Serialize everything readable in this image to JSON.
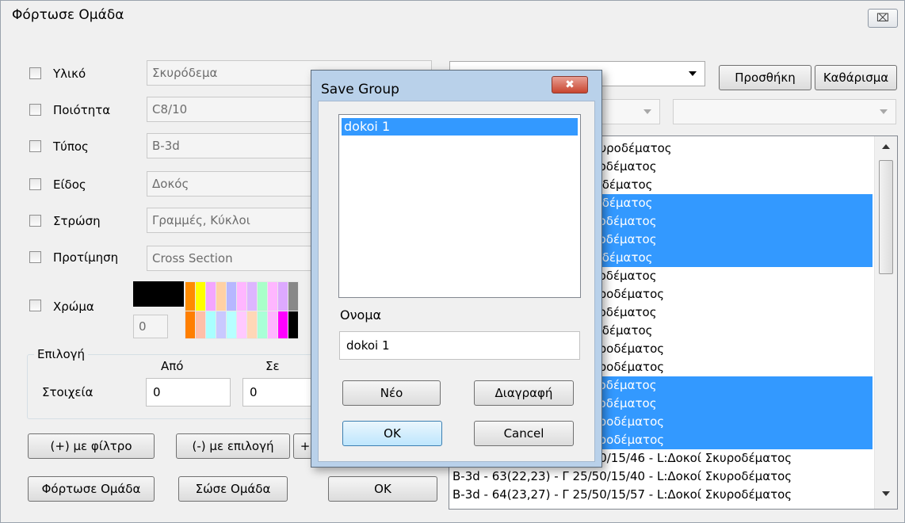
{
  "window": {
    "title": "Φόρτωσε Ομάδα",
    "close_glyph": "⌧"
  },
  "filters": [
    {
      "label": "Υλικό",
      "value": "Σκυρόδεμα"
    },
    {
      "label": "Ποιότητα",
      "value": "C8/10"
    },
    {
      "label": "Τύπος",
      "value": "B-3d"
    },
    {
      "label": "Είδος",
      "value": "Δοκός"
    },
    {
      "label": "Στρώση",
      "value": "Γραμμές, Κύκλοι"
    },
    {
      "label": "Προτίμηση",
      "value": "Cross Section"
    }
  ],
  "color": {
    "label": "Χρώμα",
    "index_value": "0"
  },
  "selection": {
    "group_label": "Επιλογή",
    "from_label": "Από",
    "to_label": "Σε",
    "items_label": "Στοιχεία",
    "from_value": "0",
    "to_value": "0"
  },
  "buttons": {
    "with_filter": "(+) με φίλτρο",
    "minus_selection": "(-) με επιλογή",
    "plus_cut": "+",
    "load_group": "Φόρτωσε Ομάδα",
    "save_group": "Σώσε Ομάδα",
    "ok": "OK",
    "add": "Προσθήκη",
    "clear": "Καθάρισμα"
  },
  "list_rows": [
    {
      "text": "25/50/15/40 - L:Δοκοί Σκυροδέματος",
      "selected": false
    },
    {
      "text": "/50/15/47 - L:Δοκοί Σκυροδέματος",
      "selected": false
    },
    {
      "text": "50/15/46 - L:Δοκοί Σκυροδέματος",
      "selected": false
    },
    {
      "text": "50/15/40 - L:Δοκοί Σκυροδέματος",
      "selected": true
    },
    {
      "text": "/50/15/57 - L:Δοκοί Σκυροδέματος",
      "selected": true
    },
    {
      "text": "/50/15/68 - L:Δοκοί Σκυροδέματος",
      "selected": true
    },
    {
      "text": "50/15/67 - L:Δοκοί Σκυροδέματος",
      "selected": true
    },
    {
      "text": "/50/15/67 - L:Δοκοί Σκυροδέματος",
      "selected": false
    },
    {
      "text": "5/50/15/89 - L:Δοκοί Σκυροδέματος",
      "selected": false
    },
    {
      "text": "/50/15/61 - L:Δοκοί Σκυροδέματος",
      "selected": false
    },
    {
      "text": "50/15/61 - L:Δοκοί Σκυροδέματος",
      "selected": false
    },
    {
      "text": "5/50/15/69 - L:Δοκοί Σκυροδέματος",
      "selected": false
    },
    {
      "text": "5/50/15/67 - L:Δοκοί Σκυροδέματος",
      "selected": false
    },
    {
      "text": "/50/15/38 - L:Δοκοί Σκυροδέματος",
      "selected": true
    },
    {
      "text": "/50/15/45 - L:Δοκοί Σκυροδέματος",
      "selected": true
    },
    {
      "text": "5/50/15/40 - L:Δοκοί Σκυροδέματος",
      "selected": true
    },
    {
      "text": "5/50/15/47 - L:Δοκοί Σκυροδέματος",
      "selected": true
    },
    {
      "text": "B-3d - 62(24,22) - Γ 25/50/15/46 - L:Δοκοί Σκυροδέματος",
      "selected": false
    },
    {
      "text": "B-3d - 63(22,23) - Γ 25/50/15/40 - L:Δοκοί Σκυροδέματος",
      "selected": false
    },
    {
      "text": "B-3d - 64(23,27) - Γ 25/50/15/57 - L:Δοκοί Σκυροδέματος",
      "selected": false
    }
  ],
  "palette": {
    "big": "#000000",
    "row1": [
      "#ff8c00",
      "#ffff00",
      "#f4a6ff",
      "#ffd1a4",
      "#b7b7ff",
      "#ffb6ff",
      "#ddb6ff",
      "#a9ffc9",
      "#ffb6ff",
      "#dda9ff",
      "#888888"
    ],
    "row2": [
      "#ff7f00",
      "#ffbfa9",
      "#a9ffff",
      "#c9c9ff",
      "#b7ffff",
      "#ffc9ff",
      "#ffd7b7",
      "#a9ffd7",
      "#ffb6ff",
      "#ff00ff",
      "#000000"
    ]
  },
  "save_dialog": {
    "title": "Save Group",
    "close_glyph": "✖",
    "items": [
      "dokoi 1"
    ],
    "name_label": "Ονομα",
    "name_value": "dokoi 1",
    "new_label": "Νέο",
    "delete_label": "Διαγραφή",
    "ok_label": "OK",
    "cancel_label": "Cancel"
  }
}
